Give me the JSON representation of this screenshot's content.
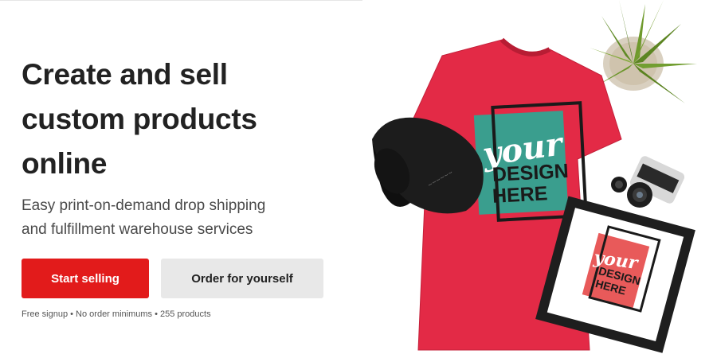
{
  "hero": {
    "headline_lines": [
      "Create and sell",
      "custom products",
      "online"
    ],
    "subhead_lines": [
      "Easy print-on-demand drop shipping",
      "and fulfillment warehouse services"
    ],
    "primary_button": "Start selling",
    "secondary_button": "Order for yourself",
    "fine_print": "Free signup • No order minimums • 255 products"
  },
  "image": {
    "tshirt_text": [
      "your",
      "DESIGN",
      "HERE"
    ],
    "frame_text": [
      "your",
      "DESIGN",
      "HERE"
    ],
    "colors": {
      "tshirt": "#e32a46",
      "tshirt_panel": "#3a9e8e",
      "frame_panel": "#e85a5a",
      "cap": "#1c1c1c",
      "plant": "#6a8a2a",
      "button_primary": "#e21b1b",
      "button_secondary": "#e8e8e8"
    }
  }
}
